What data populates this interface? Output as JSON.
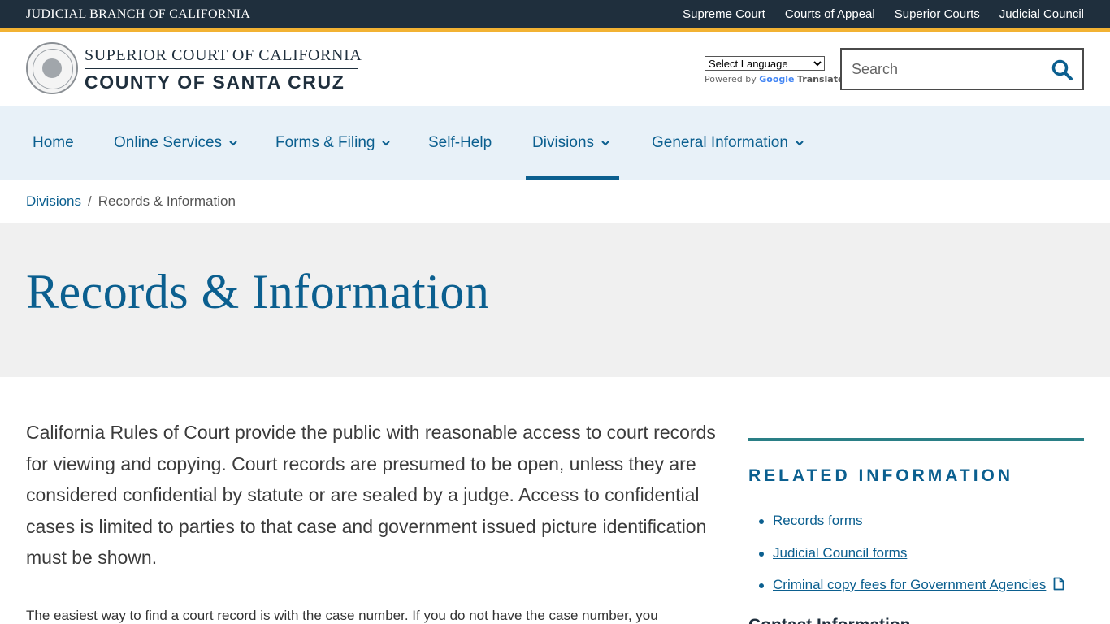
{
  "topbar": {
    "branch": "JUDICIAL BRANCH OF CALIFORNIA",
    "links": [
      "Supreme Court",
      "Courts of Appeal",
      "Superior Courts",
      "Judicial Council"
    ]
  },
  "header": {
    "logo_line1": "SUPERIOR COURT OF CALIFORNIA",
    "logo_line2": "COUNTY OF SANTA CRUZ",
    "translate_select": "Select Language",
    "powered_by": "Powered by",
    "google": "Google",
    "translate": "Translate",
    "search_placeholder": "Search"
  },
  "nav": {
    "items": [
      "Home",
      "Online Services",
      "Forms & Filing",
      "Self-Help",
      "Divisions",
      "General Information"
    ],
    "active": "Divisions"
  },
  "breadcrumb": {
    "parent": "Divisions",
    "separator": "/",
    "current": "Records & Information"
  },
  "page": {
    "title": "Records & Information",
    "lead": "California Rules of Court provide the public with reasonable access to court records for viewing and copying. Court records are presumed to be open, unless they are considered confidential by statute or are sealed by a judge. Access to confidential cases is limited to parties to that case and government issued picture identification must be shown.",
    "body": "The easiest way to find a court record is with the case number. If you do not have the case number, you"
  },
  "sidebar": {
    "title": "RELATED INFORMATION",
    "links": [
      "Records forms",
      "Judicial Council forms",
      "Criminal copy fees for Government Agencies"
    ],
    "contact": "Contact Information"
  },
  "colors": {
    "topbar": "#1f2f3d",
    "accent_gold": "#f2b233",
    "brand_blue": "#0b5f8f",
    "nav_bg": "#e8f1f8",
    "hero_bg": "#f0f0f0",
    "sidebar_rule": "#2a7f86"
  }
}
